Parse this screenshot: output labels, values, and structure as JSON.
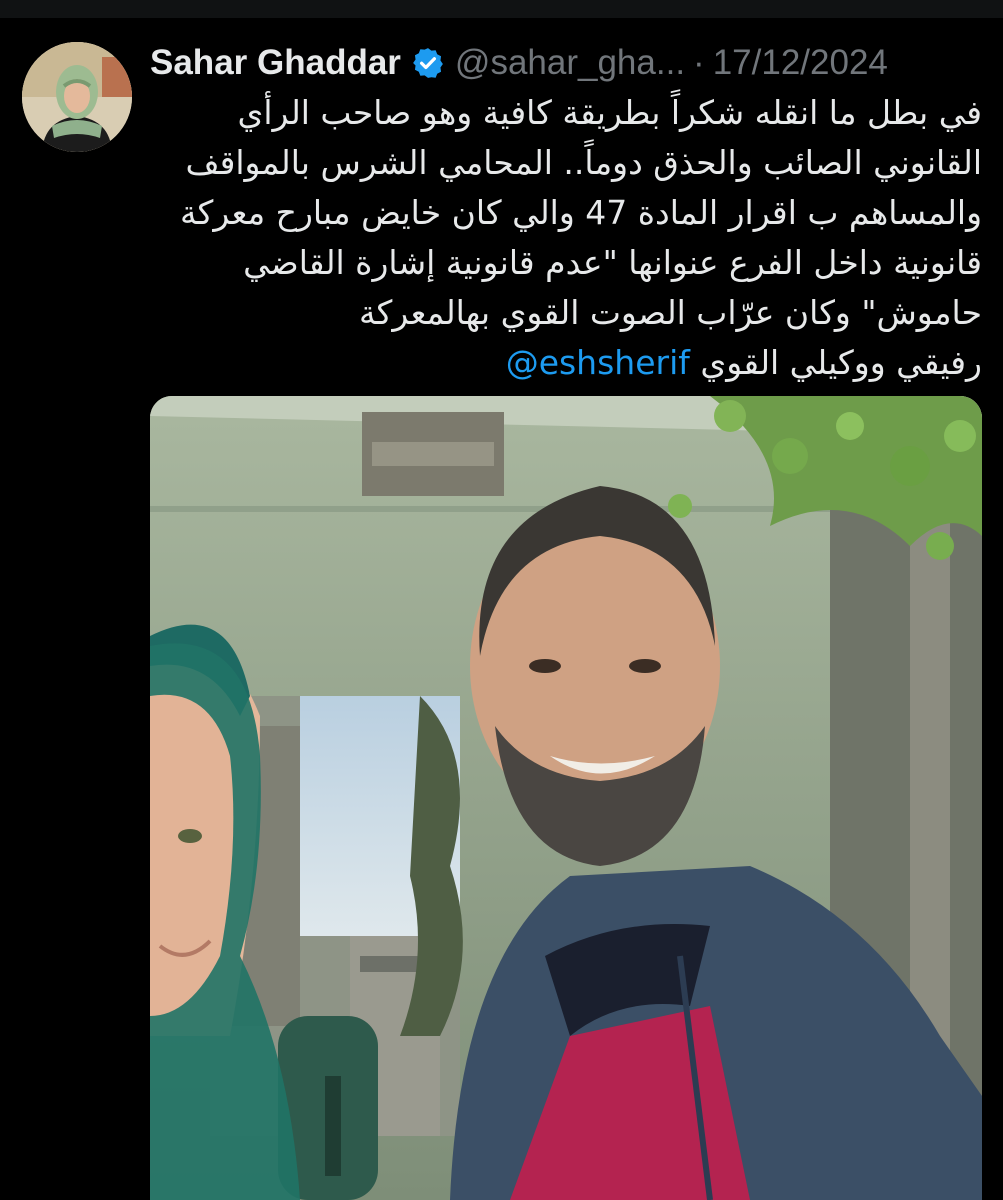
{
  "tweet": {
    "author": {
      "display_name": "Sahar Ghaddar",
      "handle": "@sahar_gha...",
      "verified": true
    },
    "separator": "·",
    "date": "17/12/2024",
    "text_lines": [
      "في بطل ما انقله شكراً بطريقة كافية وهو صاحب الرأي",
      "القانوني الصائب والحذق دوماً.. المحامي الشرس بالمواقف",
      "والمساهم ب اقرار المادة 47 والي كان خايض مبارح معركة",
      "قانونية داخل الفرع عنوانها \"عدم قانونية إشارة القاضي",
      "حاموش\" وكان عرّاب الصوت القوي بهالمعركة"
    ],
    "last_line_text": "رفيقي ووكيلي القوي",
    "mention": "@eshsherif"
  },
  "colors": {
    "background": "#000000",
    "text": "#e7e9ea",
    "muted": "#71767b",
    "link": "#1d9bf0",
    "verified_badge": "#1d9bf0"
  },
  "icons": {
    "verified": "verified-badge-icon"
  }
}
